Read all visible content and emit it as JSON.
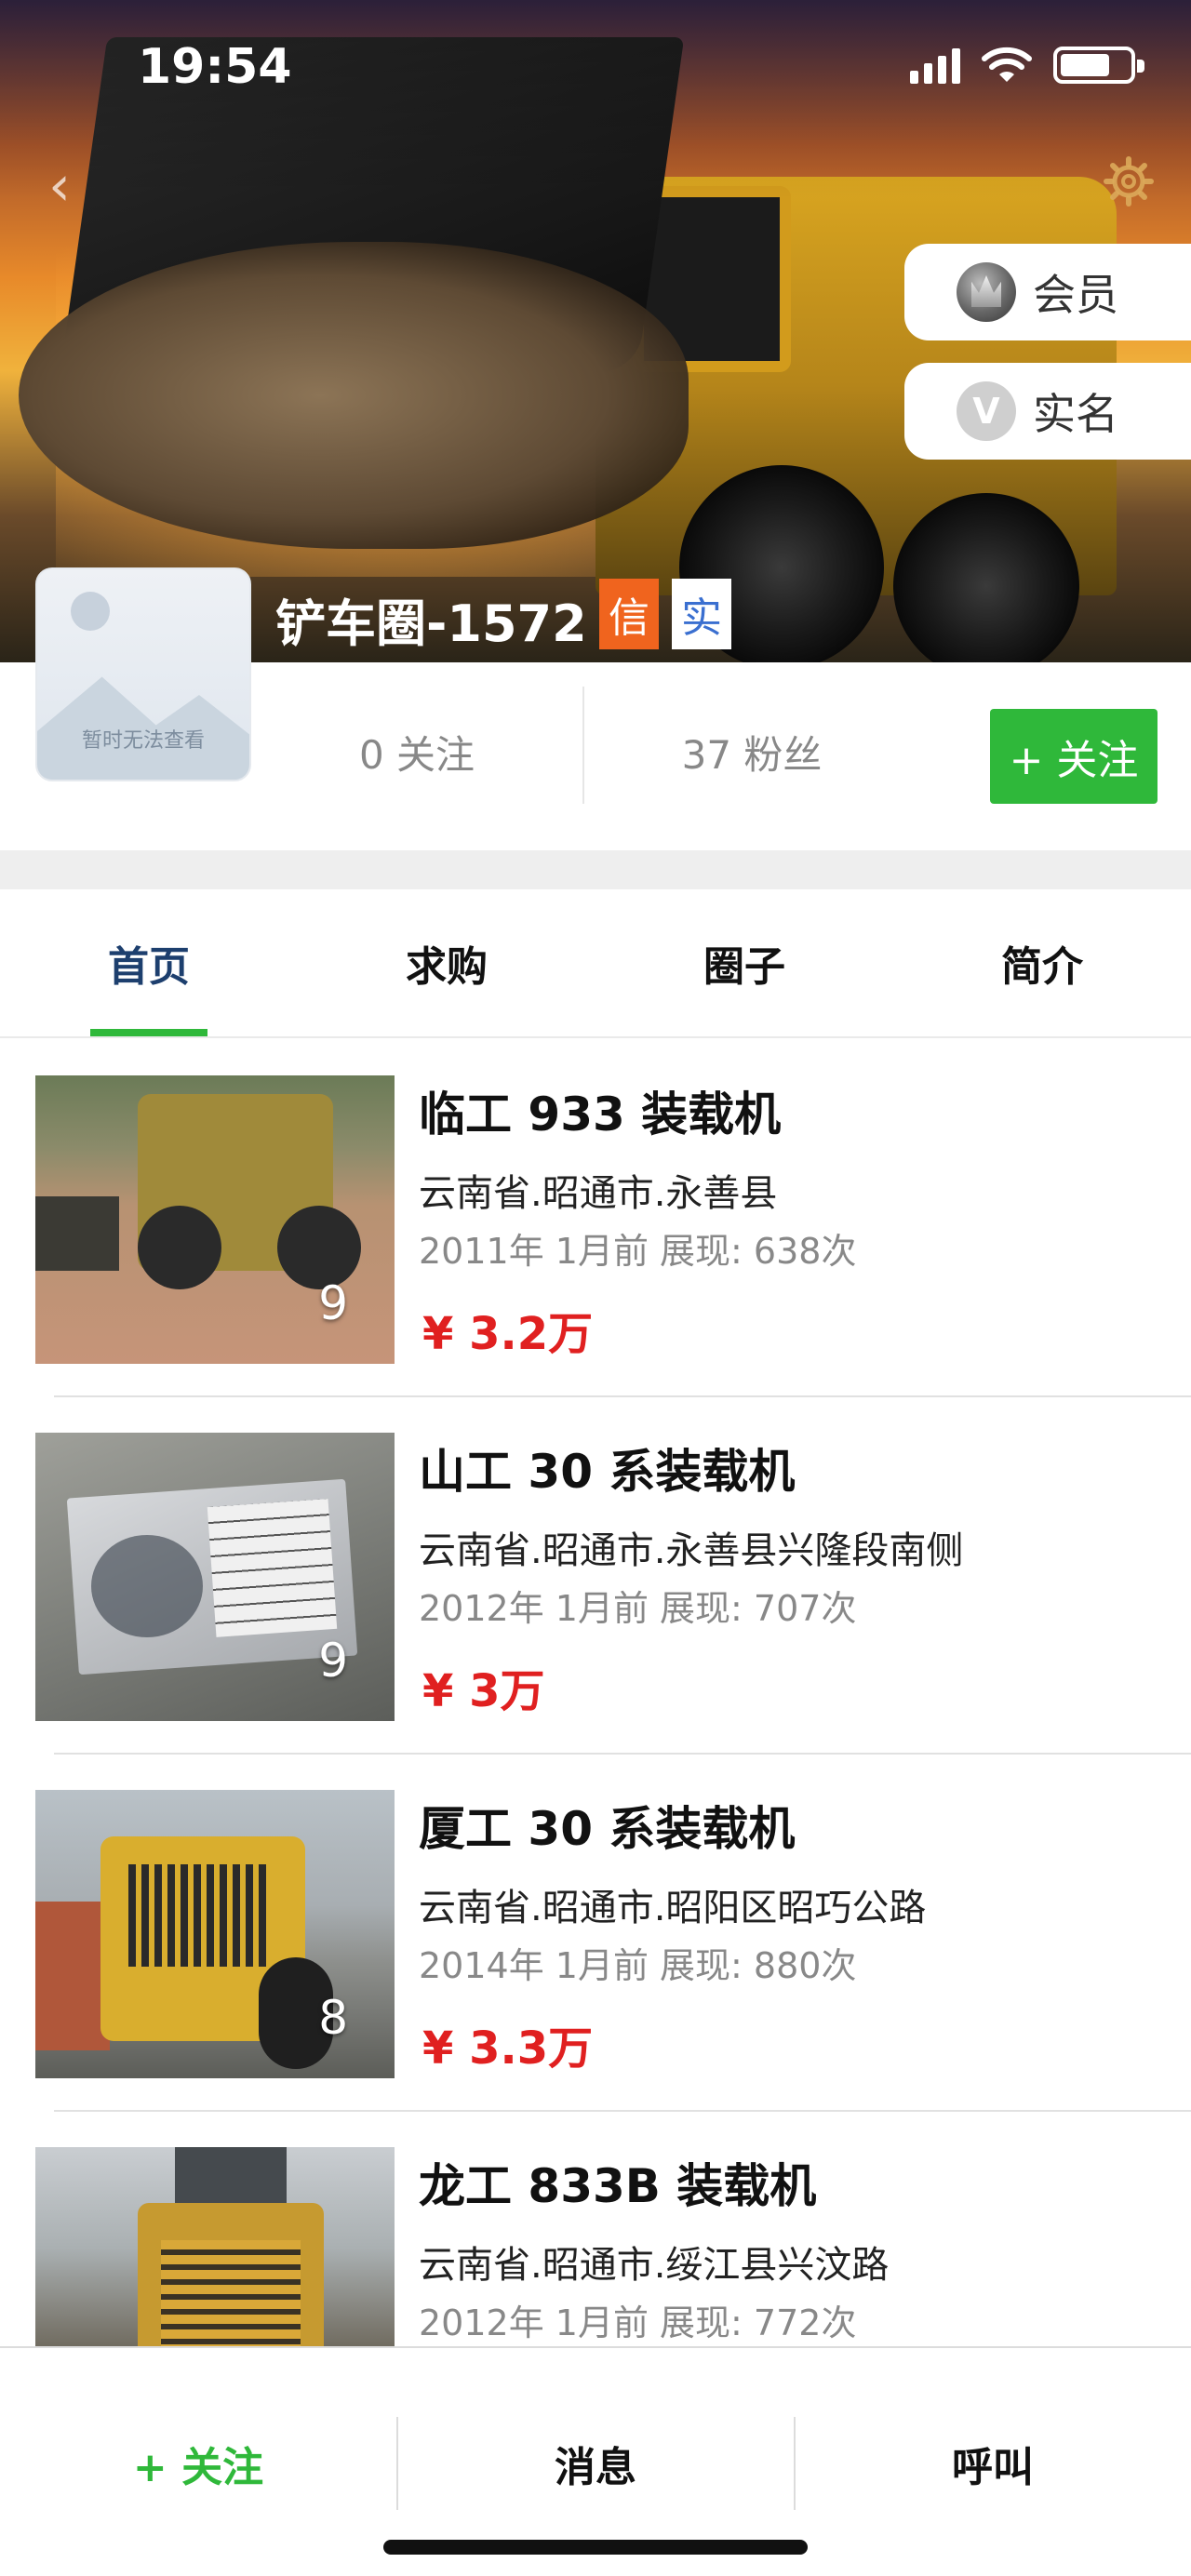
{
  "status_bar": {
    "time": "19:54"
  },
  "header": {
    "name": "铲车圈-1572",
    "badge_credit": "信",
    "badge_real": "实",
    "member_label": "会员",
    "realname_label": "实名",
    "avatar_caption": "暂时无法查看"
  },
  "stats": {
    "following": "0 关注",
    "fans": "37 粉丝",
    "follow_button": "+ 关注"
  },
  "tabs": [
    {
      "label": "首页"
    },
    {
      "label": "求购"
    },
    {
      "label": "圈子"
    },
    {
      "label": "简介"
    }
  ],
  "listings": [
    {
      "title": "临工 933 装载机",
      "location": "云南省.昭通市.永善县",
      "meta": "2011年  1月前  展现: 638次",
      "price": "¥ 3.2万",
      "photo_count": "9"
    },
    {
      "title": "山工 30 系装载机",
      "location": "云南省.昭通市.永善县兴隆段南侧",
      "meta": "2012年  1月前  展现: 707次",
      "price": "¥ 3万",
      "photo_count": "9"
    },
    {
      "title": "厦工 30 系装载机",
      "location": "云南省.昭通市.昭阳区昭巧公路",
      "meta": "2014年  1月前  展现: 880次",
      "price": "¥ 3.3万",
      "photo_count": "8"
    },
    {
      "title": "龙工 833B 装载机",
      "location": "云南省.昭通市.绥江县兴汶路",
      "meta": "2012年  1月前  展现: 772次",
      "price": "",
      "photo_count": ""
    }
  ],
  "bottom_bar": {
    "follow": "+ 关注",
    "message": "消息",
    "call": "呼叫"
  },
  "colors": {
    "accent_green": "#2fb83a",
    "price_red": "#e02020",
    "badge_orange": "#f0641e"
  }
}
